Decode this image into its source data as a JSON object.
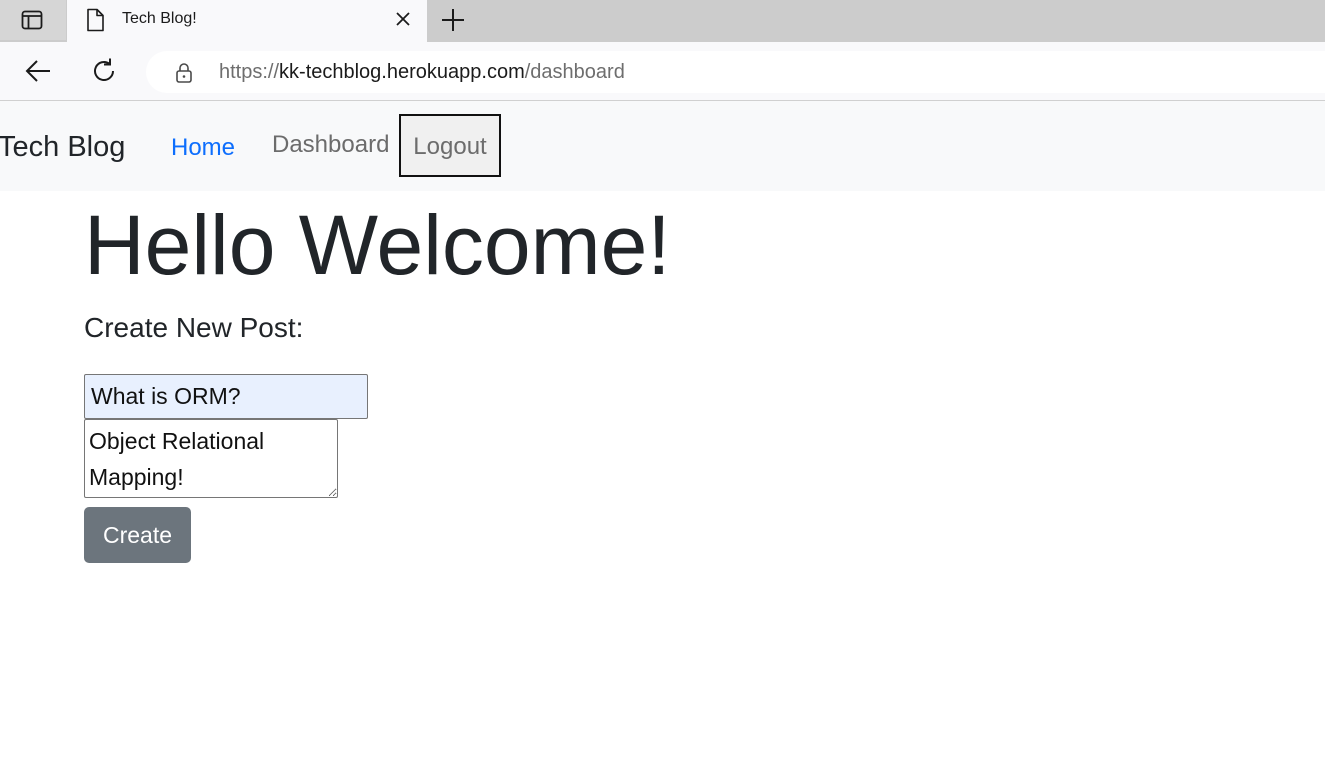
{
  "browser": {
    "tab_title": "Tech Blog!",
    "url_scheme": "https://",
    "url_host": "kk-techblog.herokuapp.com",
    "url_path": "/dashboard",
    "icons": [
      "sidebar-toggle-icon",
      "page-icon",
      "close-icon",
      "plus-icon",
      "back-arrow-icon",
      "reload-icon",
      "lock-icon"
    ]
  },
  "navbar": {
    "brand": "Tech Blog",
    "links": {
      "home": "Home",
      "dashboard": "Dashboard",
      "logout": "Logout"
    },
    "colors": {
      "home_link": "#0d6efd",
      "muted_link": "#6c6c6c",
      "background": "#f8f9fa"
    }
  },
  "main": {
    "heading": "Hello Welcome!",
    "subheading": "Create New Post:",
    "form": {
      "title_value": "What is ORM?",
      "body_value": "Object Relational Mapping!",
      "submit_label": "Create",
      "submit_color": "#6c757d"
    }
  }
}
